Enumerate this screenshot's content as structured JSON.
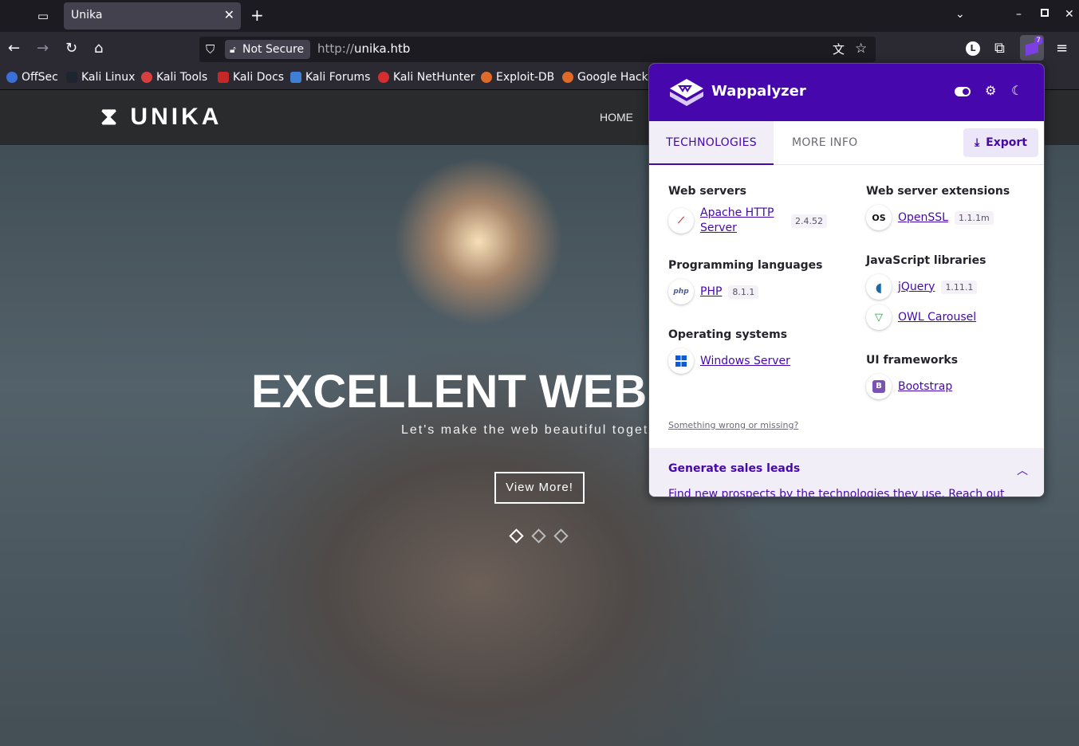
{
  "browser": {
    "tab_title": "Unika",
    "tab_close": "✕",
    "new_tab": "+",
    "not_secure": "Not Secure",
    "url_protocol": "http://",
    "url_host": "unika.htb",
    "extension_badge": "7",
    "bookmarks": [
      "OffSec",
      "Kali Linux",
      "Kali Tools",
      "Kali Docs",
      "Kali Forums",
      "Kali NetHunter",
      "Exploit-DB",
      "Google Hacki"
    ]
  },
  "site": {
    "logo": "UNIKA",
    "nav_home": "HOME",
    "hero_title": "EXCELLENT WEB D",
    "hero_subtitle": "Let's make the web beautiful toget",
    "hero_button": "View More!"
  },
  "wappalyzer": {
    "name": "Wappalyzer",
    "tabs": {
      "technologies": "TECHNOLOGIES",
      "more_info": "MORE INFO"
    },
    "export": "Export",
    "categories": {
      "web_servers": {
        "label": "Web servers",
        "tech": "Apache HTTP Server",
        "tech_line1": "Apache HTTP",
        "tech_line2": "Server",
        "version": "2.4.52"
      },
      "web_server_extensions": {
        "label": "Web server extensions",
        "tech": "OpenSSL",
        "version": "1.1.1m"
      },
      "programming_languages": {
        "label": "Programming languages",
        "tech": "PHP",
        "version": "8.1.1"
      },
      "javascript_libraries": {
        "label": "JavaScript libraries",
        "tech1": "jQuery",
        "version1": "1.11.1",
        "tech2": "OWL Carousel"
      },
      "operating_systems": {
        "label": "Operating systems",
        "tech": "Windows Server"
      },
      "ui_frameworks": {
        "label": "UI frameworks",
        "tech": "Bootstrap"
      }
    },
    "wrong_link": "Something wrong or missing?",
    "leads_title": "Generate sales leads",
    "leads_text": "Find new prospects by the technologies they use. Reach out"
  },
  "colors": {
    "accent": "#4608ad",
    "tabstrip": "#1c1b22",
    "toolbar": "#2b2a33"
  }
}
